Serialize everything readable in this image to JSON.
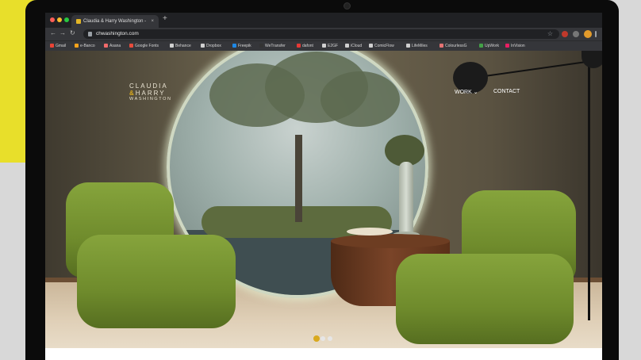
{
  "browser": {
    "tab_title": "Claudia & Harry Washington -",
    "tab_close": "×",
    "new_tab": "+",
    "url": "chwashington.com",
    "nav": {
      "back": "←",
      "forward": "→",
      "reload": "↻"
    },
    "bookmark_star": "☆",
    "traffic_lights": [
      "#ff5f57",
      "#febc2e",
      "#28c840"
    ],
    "bookmarks": [
      "Gmail",
      "e-Banco",
      "Asana",
      "Google Fonts",
      "Behance",
      "Dropbox",
      "Freepik",
      "WeTransfer",
      "dafont",
      "E2GF",
      "iCloud",
      "ComicFlow",
      "LifeMiles",
      "ColourlessG",
      "UpWork",
      "InVision"
    ]
  },
  "site": {
    "logo": {
      "line1": "CLAUDIA",
      "amp": "&",
      "line2": "HARRY",
      "line3": "WASHINGTON"
    },
    "nav": {
      "work": "WORK",
      "work_icon": "chevron-down-icon",
      "work_chevron": "⌄",
      "contact": "CONTACT"
    },
    "carousel": {
      "slide_count": 3,
      "active_index": 0,
      "active_color": "#d9a91e",
      "inactive_color": "#e6e6e6"
    }
  },
  "colors": {
    "accent": "#e8df2a",
    "logo_accent": "#d9a91e",
    "chair_green": "#7a9835"
  }
}
